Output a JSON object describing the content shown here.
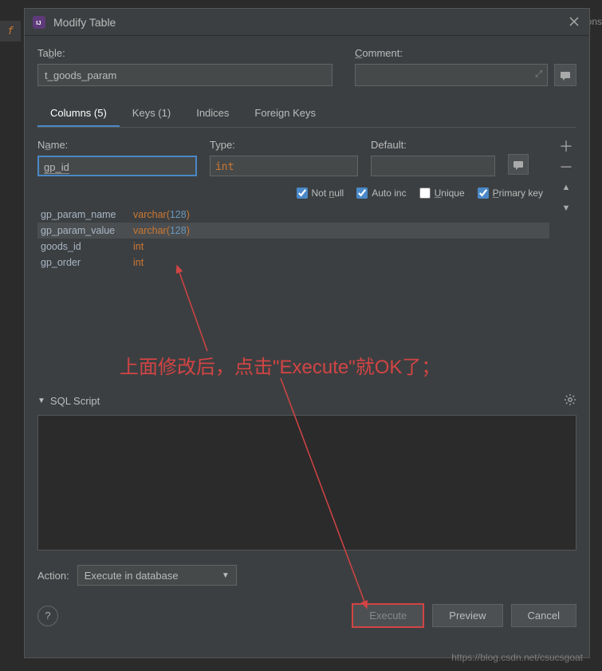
{
  "bg": {
    "left_tab": "f",
    "right_hint": "ons"
  },
  "dialog": {
    "title": "Modify Table",
    "table_label": "Table:",
    "comment_label": "Comment:",
    "table_value": "t_goods_param",
    "tabs": {
      "columns": "Columns (5)",
      "keys": "Keys (1)",
      "indices": "Indices",
      "fk": "Foreign Keys"
    },
    "col_hdr": {
      "name": "Name:",
      "type": "Type:",
      "default": "Default:"
    },
    "active_col": {
      "name": "gp_id",
      "type": "int"
    },
    "checks": {
      "notnull": "Not null",
      "autoinc": "Auto inc",
      "unique": "Unique",
      "pk": "Primary key"
    },
    "columns": [
      {
        "n": "gp_param_name",
        "t": "varchar",
        "len": "128"
      },
      {
        "n": "gp_param_value",
        "t": "varchar",
        "len": "128"
      },
      {
        "n": "goods_id",
        "t": "int",
        "len": ""
      },
      {
        "n": "gp_order",
        "t": "int",
        "len": ""
      }
    ],
    "sql_label": "SQL Script",
    "action_label": "Action:",
    "action_value": "Execute in database",
    "buttons": {
      "execute": "Execute",
      "preview": "Preview",
      "cancel": "Cancel"
    }
  },
  "annotation": "上面修改后，点击\"Execute\"就OK了；",
  "watermark": "https://blog.csdn.net/csucsgoat"
}
